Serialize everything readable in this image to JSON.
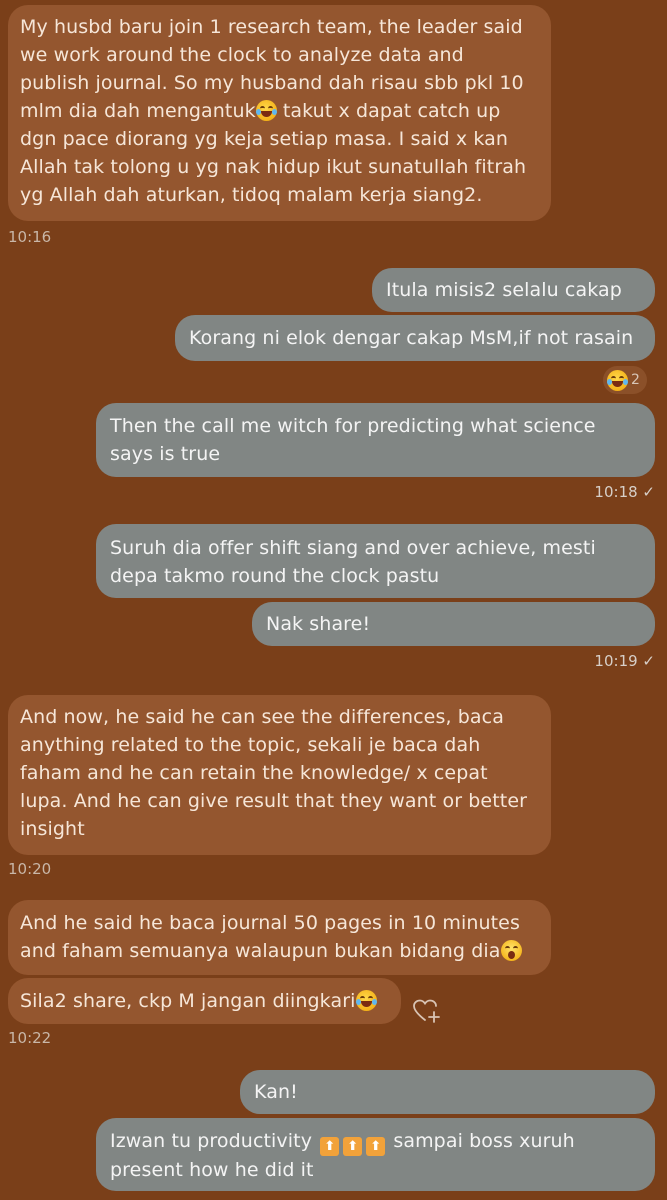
{
  "messages": [
    {
      "text": "My husbd baru join 1 research team, the leader said we work around the clock to analyze data and publish journal. So my husband dah risau sbb pkl 10 mlm dia dah mengantuk",
      "text_after": " takut x dapat catch up dgn pace diorang yg keja setiap masa. I said x kan Allah tak tolong u yg nak hidup ikut sunatullah fitrah yg Allah dah aturkan, tidoq malam kerja siang2.",
      "emoji": "rofl-emoji",
      "time": "10:16"
    },
    {
      "text": "Itula misis2 selalu cakap"
    },
    {
      "text": "Korang ni elok dengar cakap MsM,if not rasain",
      "reaction_count": "2",
      "reaction_emoji": "joy-emoji"
    },
    {
      "text": "Then the call me witch for predicting what science says is true",
      "time": "10:18 ✓"
    },
    {
      "text": "Suruh dia offer shift siang and over achieve, mesti depa takmo round the clock pastu"
    },
    {
      "text": "Nak share!",
      "time": "10:19 ✓"
    },
    {
      "text": "And now, he said he can see the differences, baca anything related to the topic, sekali je baca dah faham and he can retain the knowledge/ x cepat lupa. And he can give result that they want or better insight",
      "time": "10:20"
    },
    {
      "text": "And he said he baca journal 50 pages in 10 minutes and faham semuanya walaupun bukan bidang dia",
      "emoji": "scream-emoji"
    },
    {
      "text": "Sila2 share, ckp M jangan diingkari",
      "emoji": "rofl-emoji",
      "time": "10:22"
    },
    {
      "text": "Kan!"
    },
    {
      "text": "Izwan tu productivity ",
      "arrow_symbol": "⬆",
      "text_after": " sampai boss xuruh present how he did it"
    }
  ]
}
